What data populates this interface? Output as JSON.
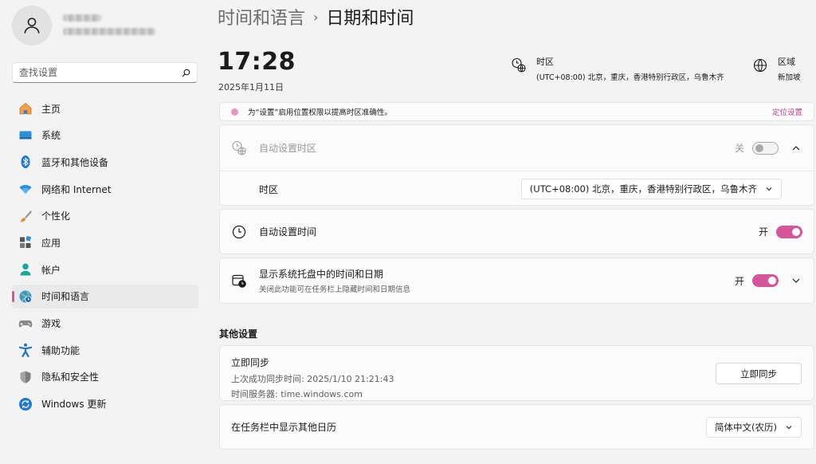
{
  "sidebar": {
    "search_placeholder": "查找设置",
    "items": [
      {
        "label": "主页",
        "icon": "home-icon"
      },
      {
        "label": "系统",
        "icon": "system-display-icon"
      },
      {
        "label": "蓝牙和其他设备",
        "icon": "bluetooth-icon"
      },
      {
        "label": "网络和 Internet",
        "icon": "wifi-icon"
      },
      {
        "label": "个性化",
        "icon": "brush-icon"
      },
      {
        "label": "应用",
        "icon": "apps-icon"
      },
      {
        "label": "帐户",
        "icon": "account-icon"
      },
      {
        "label": "时间和语言",
        "icon": "globe-clock-icon",
        "active": true
      },
      {
        "label": "游戏",
        "icon": "gamepad-icon"
      },
      {
        "label": "辅助功能",
        "icon": "accessibility-icon"
      },
      {
        "label": "隐私和安全性",
        "icon": "shield-icon"
      },
      {
        "label": "Windows 更新",
        "icon": "update-icon"
      }
    ],
    "accent_color": "#d6559a"
  },
  "header": {
    "parent": "时间和语言",
    "separator": "›",
    "current": "日期和时间"
  },
  "clock": {
    "time": "17:28",
    "date": "2025年1月11日"
  },
  "timezone_info": {
    "title": "时区",
    "value": "(UTC+08:00) 北京，重庆，香港特别行政区，乌鲁木齐"
  },
  "region_info": {
    "title": "区域",
    "value": "新加坡"
  },
  "banner": {
    "text": "为“设置”启用位置权限以提高时区准确性。",
    "link": "定位设置"
  },
  "auto_timezone": {
    "label": "自动设置时区",
    "state": "关",
    "timezone_label": "时区",
    "timezone_value": "(UTC+08:00) 北京，重庆，香港特别行政区，乌鲁木齐"
  },
  "auto_time": {
    "label": "自动设置时间",
    "state": "开"
  },
  "tray": {
    "label": "显示系统托盘中的时间和日期",
    "sublabel": "关闭此功能可在任务栏上隐藏时间和日期信息",
    "state": "开"
  },
  "other": {
    "section_title": "其他设置",
    "sync_title": "立即同步",
    "last_sync": "上次成功同步时间: 2025/1/10 21:21:43",
    "time_server": "时间服务器: time.windows.com",
    "sync_button": "立即同步",
    "calendar_label": "在任务栏中显示其他日历",
    "calendar_value": "简体中文(农历)"
  }
}
